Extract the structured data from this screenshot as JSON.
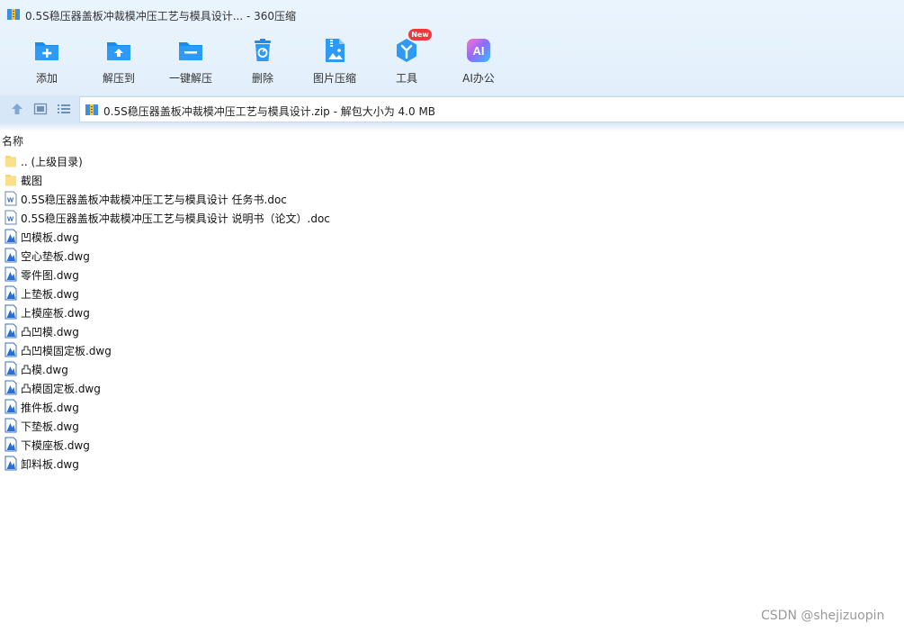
{
  "window": {
    "title": "0.5S稳压器盖板冲裁模冲压工艺与模具设计... - 360压缩"
  },
  "toolbar": {
    "buttons": [
      {
        "label": "添加",
        "icon": "add-folder-icon"
      },
      {
        "label": "解压到",
        "icon": "extract-to-icon"
      },
      {
        "label": "一键解压",
        "icon": "one-click-extract-icon"
      },
      {
        "label": "删除",
        "icon": "trash-icon"
      },
      {
        "label": "图片压缩",
        "icon": "image-compress-icon"
      },
      {
        "label": "工具",
        "icon": "tools-icon",
        "badge": "New"
      },
      {
        "label": "AI办公",
        "icon": "ai-office-icon",
        "icon_text": "AI"
      }
    ]
  },
  "address": {
    "text": "0.5S稳压器盖板冲裁模冲压工艺与模具设计.zip - 解包大小为 4.0 MB"
  },
  "list": {
    "column_name": "名称",
    "items": [
      {
        "name": ".. (上级目录)",
        "type": "folder"
      },
      {
        "name": "截图",
        "type": "folder"
      },
      {
        "name": "0.5S稳压器盖板冲裁模冲压工艺与模具设计 任务书.doc",
        "type": "doc"
      },
      {
        "name": "0.5S稳压器盖板冲裁模冲压工艺与模具设计 说明书（论文）.doc",
        "type": "doc"
      },
      {
        "name": "凹模板.dwg",
        "type": "dwg"
      },
      {
        "name": "空心垫板.dwg",
        "type": "dwg"
      },
      {
        "name": "零件图.dwg",
        "type": "dwg"
      },
      {
        "name": "上垫板.dwg",
        "type": "dwg"
      },
      {
        "name": "上模座板.dwg",
        "type": "dwg"
      },
      {
        "name": "凸凹模.dwg",
        "type": "dwg"
      },
      {
        "name": "凸凹模固定板.dwg",
        "type": "dwg"
      },
      {
        "name": "凸模.dwg",
        "type": "dwg"
      },
      {
        "name": "凸模固定板.dwg",
        "type": "dwg"
      },
      {
        "name": "推件板.dwg",
        "type": "dwg"
      },
      {
        "name": "下垫板.dwg",
        "type": "dwg"
      },
      {
        "name": "下模座板.dwg",
        "type": "dwg"
      },
      {
        "name": "卸料板.dwg",
        "type": "dwg"
      }
    ]
  },
  "watermark": "CSDN @shejizuopin",
  "colors": {
    "accent_blue": "#1a8cf0",
    "folder_yellow": "#f7d774",
    "badge_red": "#f2373b"
  }
}
